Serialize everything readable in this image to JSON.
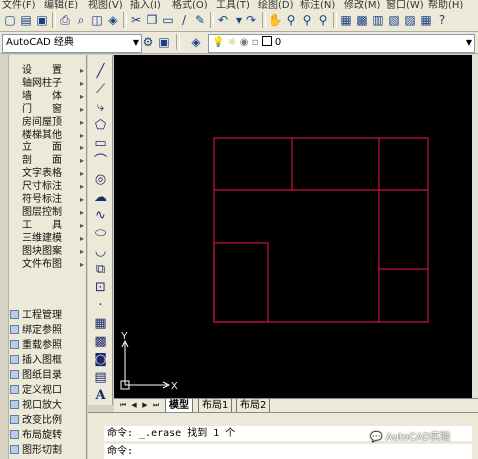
{
  "menu": [
    "文件(F)",
    "编辑(E)",
    "视图(V)",
    "插入(I)",
    "格式(O)",
    "工具(T)",
    "绘图(D)",
    "标注(N)",
    "修改(M)",
    "窗口(W)",
    "帮助(H)"
  ],
  "toolbar": {
    "workspace": "AutoCAD 经典",
    "layer_value": "0"
  },
  "tool_panel": {
    "items": [
      "设　　置",
      "轴网柱子",
      "墙　　体",
      "门　　窗",
      "房间屋顶",
      "楼梯其他",
      "立　　面",
      "剖　　面",
      "文字表格",
      "尺寸标注",
      "符号标注",
      "图层控制",
      "工　　具",
      "三维建模",
      "图块图案",
      "文件布图"
    ],
    "sub_items": [
      "工程管理",
      "绑定参照",
      "重载参照",
      "插入图框",
      "图纸目录",
      "定义视口",
      "视口放大",
      "改变比例",
      "布局旋转",
      "图形切割"
    ]
  },
  "canvas": {
    "ucs_x": "X",
    "ucs_y": "Y",
    "line_color": "#c8143c"
  },
  "tabs": [
    "模型",
    "布局1",
    "布局2"
  ],
  "command": {
    "line1": "命令: _.erase 找到 1 个",
    "line2": "命令:"
  },
  "watermark": "AutoCAD实验"
}
